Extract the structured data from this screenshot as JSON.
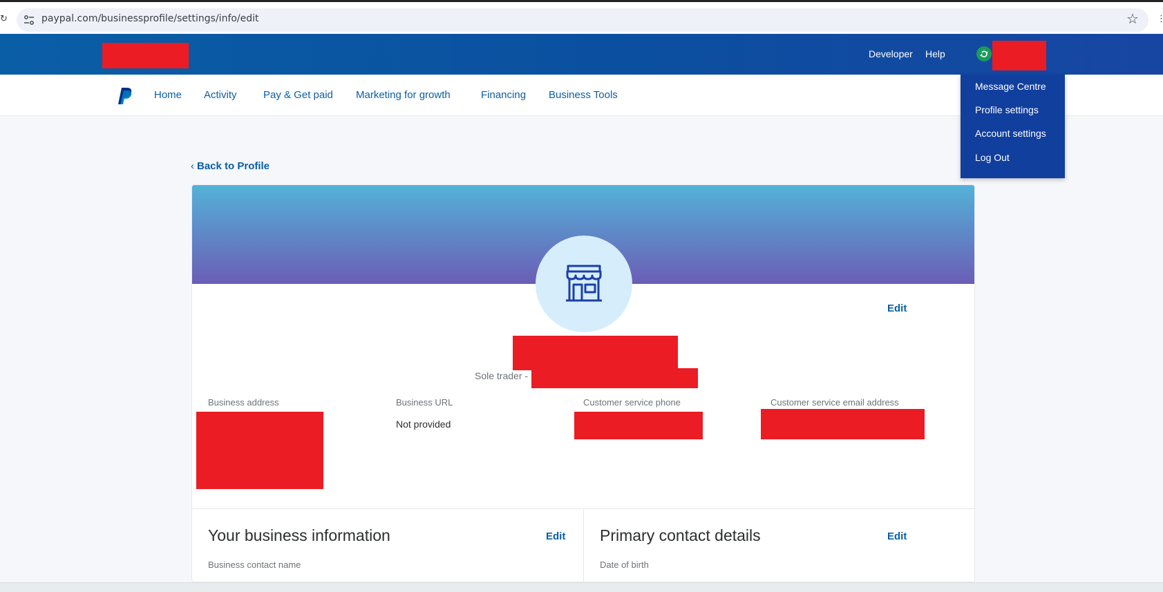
{
  "browser": {
    "url": "paypal.com/businessprofile/settings/info/edit"
  },
  "header": {
    "developer": "Developer",
    "help": "Help"
  },
  "nav": {
    "items": [
      "Home",
      "Activity",
      "Pay & Get paid",
      "Marketing for growth",
      "Financing",
      "Business Tools"
    ]
  },
  "account_menu": {
    "items": [
      "Message Centre",
      "Profile settings",
      "Account settings",
      "Log Out"
    ]
  },
  "back_link": "Back to Profile",
  "profile": {
    "edit_label": "Edit",
    "sole_trader_prefix": "Sole trader -",
    "fields": [
      {
        "label": "Business address",
        "value": ""
      },
      {
        "label": "Business URL",
        "value": "Not provided"
      },
      {
        "label": "Customer service phone",
        "value": ""
      },
      {
        "label": "Customer service email address",
        "value": ""
      }
    ]
  },
  "sections": {
    "business_info": {
      "title": "Your business information",
      "edit_label": "Edit",
      "first_label": "Business contact name"
    },
    "primary_contact": {
      "title": "Primary contact details",
      "edit_label": "Edit",
      "first_label": "Date of birth"
    }
  },
  "colors": {
    "brand_blue": "#0a5ea6",
    "header_blue": "#0b4fa0",
    "dropdown_blue": "#113f9e",
    "redaction_red": "#ec1c24"
  }
}
